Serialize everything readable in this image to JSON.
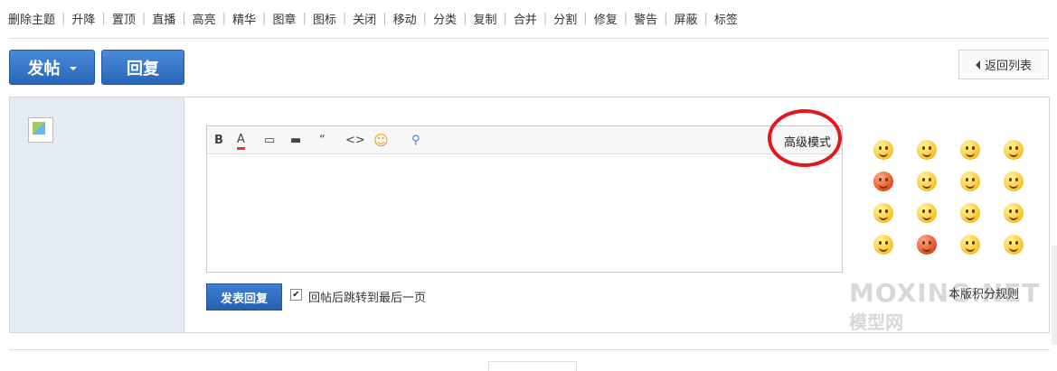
{
  "moderation": {
    "items": [
      "删除主题",
      "升降",
      "置顶",
      "直播",
      "高亮",
      "精华",
      "图章",
      "图标",
      "关闭",
      "移动",
      "分类",
      "复制",
      "合并",
      "分割",
      "修复",
      "警告",
      "屏蔽",
      "标签"
    ]
  },
  "actions": {
    "post_label": "发帖",
    "reply_label": "回复",
    "back_label": "返回列表"
  },
  "editor": {
    "toolbar": [
      {
        "name": "bold-icon",
        "glyph": "B"
      },
      {
        "name": "font-color-icon",
        "glyph": "A"
      },
      {
        "name": "image-icon",
        "glyph": "▭"
      },
      {
        "name": "attach-icon",
        "glyph": "▬"
      },
      {
        "name": "quote-icon",
        "glyph": "“"
      },
      {
        "name": "code-icon",
        "glyph": "<>"
      },
      {
        "name": "smiley-icon",
        "glyph": "☺"
      },
      {
        "name": "link-icon",
        "glyph": "⚲"
      }
    ],
    "advanced_mode_label": "高级模式",
    "content": ""
  },
  "submit": {
    "label": "发表回复",
    "jump_checked": true,
    "jump_label": "回帖后跳转到最后一页"
  },
  "sidebar": {
    "rules_label": "本版积分规则"
  },
  "watermark": {
    "brand": "MOXING.NET",
    "cn": "模型网"
  },
  "colors": {
    "accent": "#2a67ba",
    "annotation": "#e3171c"
  }
}
